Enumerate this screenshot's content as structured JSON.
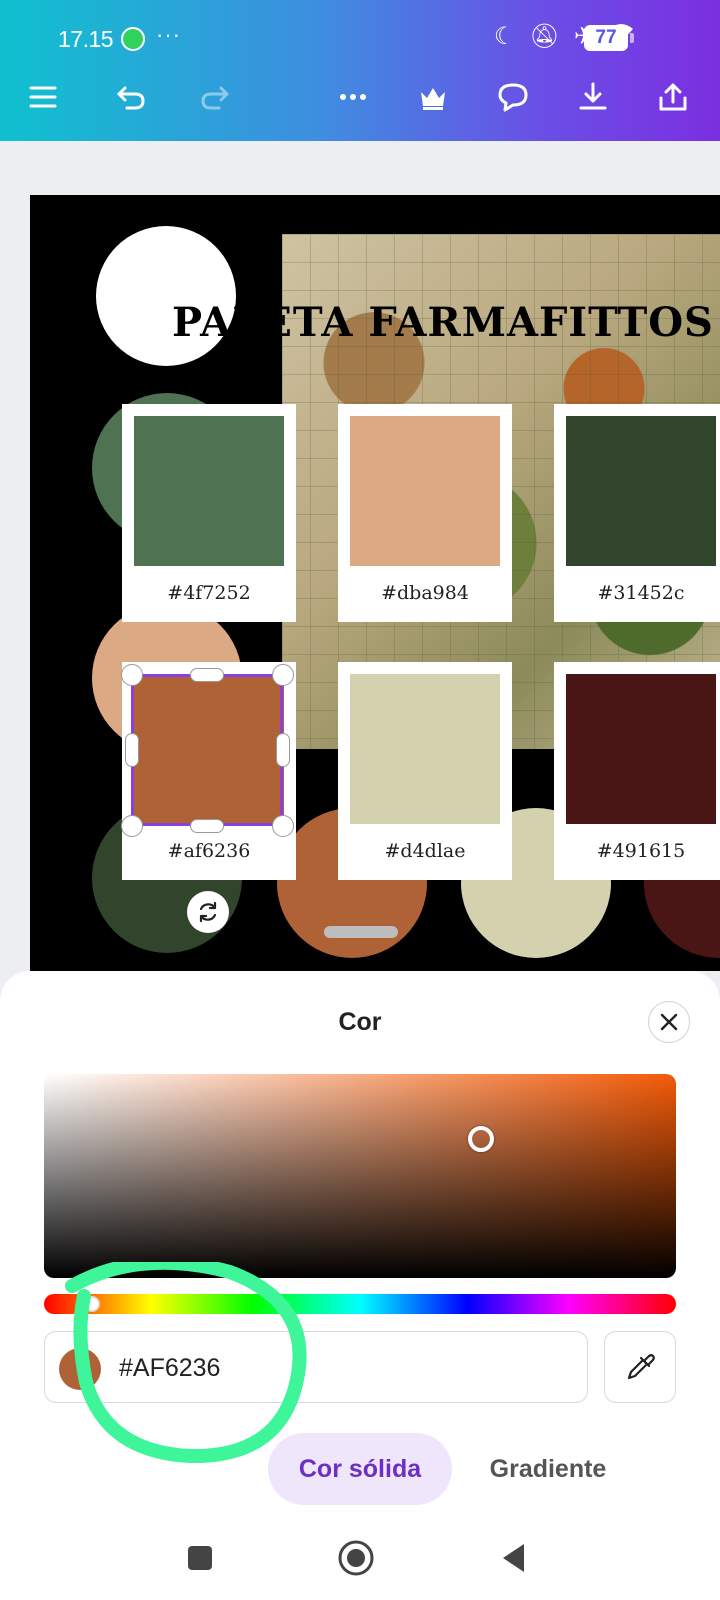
{
  "status_bar": {
    "time": "17.15",
    "battery": "77"
  },
  "design": {
    "title": "PALETA FARMAFITTOS",
    "swatches": [
      {
        "hex": "#4f7252",
        "label": "#4f7252"
      },
      {
        "hex": "#dba984",
        "label": "#dba984"
      },
      {
        "hex": "#31452c",
        "label": "#31452c"
      },
      {
        "hex": "#af6236",
        "label": "#af6236"
      },
      {
        "hex": "#d4d1ae",
        "label": "#d4dlae"
      },
      {
        "hex": "#491615",
        "label": "#491615"
      }
    ]
  },
  "color_panel": {
    "title": "Cor",
    "hex_value": "#AF6236",
    "current_color": "#af6236",
    "tabs": {
      "solid": "Cor sólida",
      "gradient": "Gradiente"
    },
    "annotation_color": "#3ef59a"
  },
  "colors": {
    "accent": "#6b2fc8",
    "selection": "#8b3fe0"
  }
}
